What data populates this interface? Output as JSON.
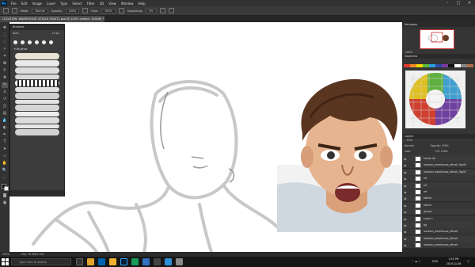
{
  "app": {
    "logo": "Ps"
  },
  "menu": [
    "File",
    "Edit",
    "Image",
    "Layer",
    "Type",
    "Select",
    "Filter",
    "3D",
    "View",
    "Window",
    "Help"
  ],
  "window_controls": [
    "–",
    "□",
    "✕"
  ],
  "options_bar": {
    "mode_label": "Mode:",
    "mode_value": "Normal",
    "opacity_label": "Opacity:",
    "opacity_value": "100%",
    "flow_label": "Flow:",
    "flow_value": "100%",
    "smoothing_label": "Smoothing:",
    "smoothing_value": "0%"
  },
  "document_tab": {
    "title": "LOCATION: WAREHOUSE ATTACK FIGHT2.psd @ 200% (sketch, RGB/8) *",
    "close": "×"
  },
  "brushes_panel": {
    "title": "Brushes",
    "size_label": "Size:",
    "size_value": "10 px",
    "folder_label": "Brushes"
  },
  "right_panels": {
    "navigator_title": "Navigator",
    "navigator_zoom": "200%",
    "swatches_title": "Swatches",
    "layers_title": "Layers",
    "kind_label": "Kind",
    "blend_mode": "Normal",
    "opacity": "Opacity: 100%",
    "lock_label": "Lock:",
    "fill": "Fill: 100%"
  },
  "swatch_colors": [
    "#e23b2e",
    "#f08a24",
    "#f5d800",
    "#5dbb3a",
    "#2a9fd8",
    "#3048a8",
    "#7a3aa0",
    "#111111",
    "#ffffff",
    "#888888",
    "#b07050"
  ],
  "layers": [
    {
      "name": "hands ref",
      "visible": true
    },
    {
      "name": "location_warehouse_attack_fight2",
      "visible": true
    },
    {
      "name": "location_warehouse_attack_fight1",
      "visible": true
    },
    {
      "name": "ref",
      "visible": true
    },
    {
      "name": "ref",
      "visible": true
    },
    {
      "name": "ref",
      "visible": true
    },
    {
      "name": "sketch",
      "visible": true
    },
    {
      "name": "sketch",
      "visible": true
    },
    {
      "name": "gloves",
      "visible": true
    },
    {
      "name": "Layer 1",
      "visible": true
    },
    {
      "name": "bg",
      "visible": true
    },
    {
      "name": "location_warehouse_attack",
      "visible": true
    },
    {
      "name": "location_warehouse_attack",
      "visible": true
    },
    {
      "name": "location_warehouse_attack",
      "visible": true
    }
  ],
  "status_bar": {
    "zoom": "200%",
    "doc_info": "Doc: 30.6M/1.20G"
  },
  "taskbar": {
    "search_placeholder": "Type here to search",
    "tray_lang": "ENG",
    "time": "2:55 PM",
    "date": "2019-11-06"
  }
}
